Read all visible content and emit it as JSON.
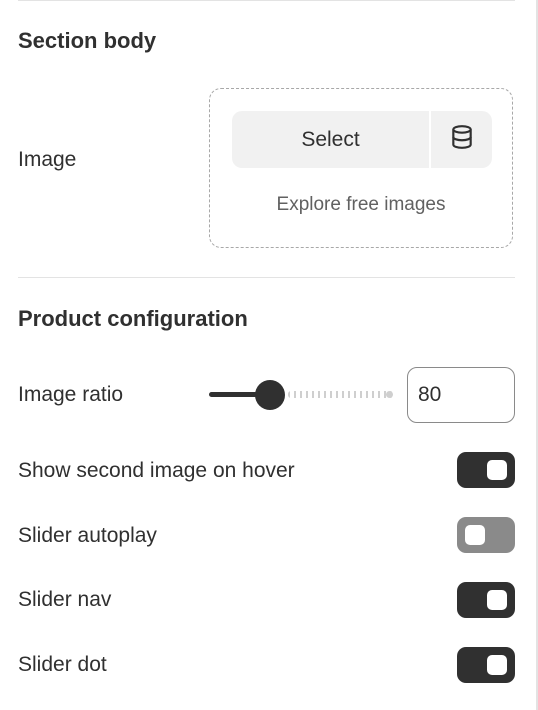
{
  "section_body": {
    "heading": "Section body",
    "image": {
      "label": "Image",
      "select_label": "Select",
      "library_icon": "database-icon",
      "explore_label": "Explore free images"
    }
  },
  "product_configuration": {
    "heading": "Product configuration",
    "image_ratio": {
      "label": "Image ratio",
      "value": "80",
      "slider_fraction": 0.33
    },
    "toggles": [
      {
        "label": "Show second image on hover",
        "on": true
      },
      {
        "label": "Slider autoplay",
        "on": false
      },
      {
        "label": "Slider nav",
        "on": true
      },
      {
        "label": "Slider dot",
        "on": true
      }
    ]
  },
  "colors": {
    "text": "#303030",
    "toggle_on": "#303030",
    "toggle_off": "#8a8a8a",
    "button_bg": "#f1f1f1"
  }
}
